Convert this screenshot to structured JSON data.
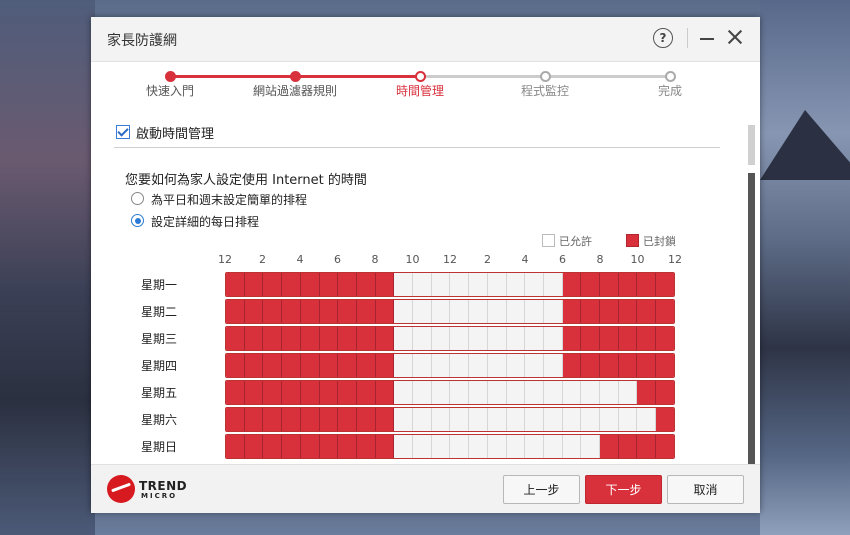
{
  "window": {
    "title": "家長防護網"
  },
  "wizard": {
    "steps": [
      {
        "label": "快速入門",
        "state": "done"
      },
      {
        "label": "網站過濾器規則",
        "state": "done"
      },
      {
        "label": "時間管理",
        "state": "current"
      },
      {
        "label": "程式監控",
        "state": "todo"
      },
      {
        "label": "完成",
        "state": "todo"
      }
    ]
  },
  "content": {
    "enable_label": "啟動時間管理",
    "enable_checked": true,
    "question": "您要如何為家人設定使用 Internet 的時間",
    "options": [
      {
        "label": "為平日和週末設定簡單的排程",
        "selected": false
      },
      {
        "label": "設定詳細的每日排程",
        "selected": true
      }
    ],
    "legend": {
      "allowed": "已允許",
      "blocked": "已封鎖"
    },
    "hour_ticks": [
      "12",
      "2",
      "4",
      "6",
      "8",
      "10",
      "12",
      "2",
      "4",
      "6",
      "8",
      "10",
      "12"
    ],
    "days": [
      {
        "label": "星期一",
        "blocked_hours": [
          0,
          1,
          2,
          3,
          4,
          5,
          6,
          7,
          8,
          18,
          19,
          20,
          21,
          22,
          23
        ]
      },
      {
        "label": "星期二",
        "blocked_hours": [
          0,
          1,
          2,
          3,
          4,
          5,
          6,
          7,
          8,
          18,
          19,
          20,
          21,
          22,
          23
        ]
      },
      {
        "label": "星期三",
        "blocked_hours": [
          0,
          1,
          2,
          3,
          4,
          5,
          6,
          7,
          8,
          18,
          19,
          20,
          21,
          22,
          23
        ]
      },
      {
        "label": "星期四",
        "blocked_hours": [
          0,
          1,
          2,
          3,
          4,
          5,
          6,
          7,
          8,
          18,
          19,
          20,
          21,
          22,
          23
        ]
      },
      {
        "label": "星期五",
        "blocked_hours": [
          0,
          1,
          2,
          3,
          4,
          5,
          6,
          7,
          8,
          22,
          23
        ]
      },
      {
        "label": "星期六",
        "blocked_hours": [
          0,
          1,
          2,
          3,
          4,
          5,
          6,
          7,
          8,
          23
        ]
      },
      {
        "label": "星期日",
        "blocked_hours": [
          0,
          1,
          2,
          3,
          4,
          5,
          6,
          7,
          8,
          20,
          21,
          22,
          23
        ]
      }
    ]
  },
  "footer": {
    "brand_line1": "TREND",
    "brand_line2": "MICRO",
    "back_label": "上一步",
    "next_label": "下一步",
    "cancel_label": "取消"
  },
  "colors": {
    "accent": "#d8313c",
    "allowed": "#f4f4f4",
    "pending": "#cccccc"
  }
}
